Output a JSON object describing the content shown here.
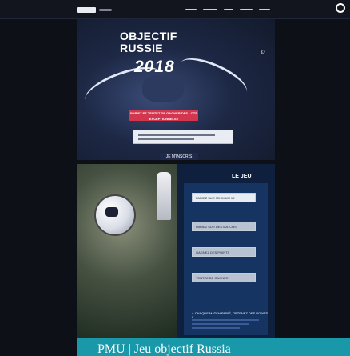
{
  "topbar": {
    "logo_label": "",
    "nav_items": [
      "",
      "",
      "",
      "",
      ""
    ]
  },
  "hero": {
    "title_line1": "OBJECTIF",
    "title_line2": "RUSSIE",
    "year": "2018",
    "promo": "PARIEZ ET TENTEZ DE GAGNER DES LOTS EXCEPTIONNELS !",
    "cta_label": "JE M'INSCRIS",
    "icon": "camera-icon"
  },
  "game": {
    "title": "LE JEU",
    "fields": [
      "PARIEZ SUR MINIMUM 1€",
      "PARIEZ SUR DES MATCHS",
      "GAGNEZ DES POINTS",
      "TENTEZ DE GAGNER"
    ],
    "note": "À CHAQUE MATCH PARIÉ, OBTENEZ DES POINTS !",
    "ball_icon": "soccer-ball-icon",
    "trophy_icon": "trophy-icon"
  },
  "footer": {
    "banner_text": "PMU | Jeu objectif Russia"
  }
}
